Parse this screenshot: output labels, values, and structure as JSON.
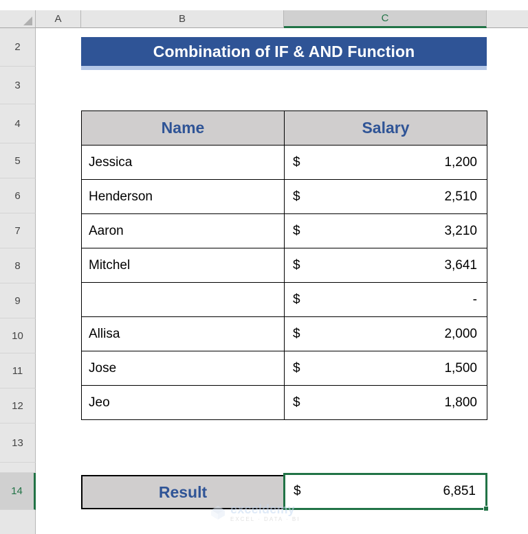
{
  "spreadsheet": {
    "columns": [
      {
        "label": "A",
        "selected": false
      },
      {
        "label": "B",
        "selected": false
      },
      {
        "label": "C",
        "selected": true
      }
    ],
    "rows": [
      "2",
      "3",
      "4",
      "5",
      "6",
      "7",
      "8",
      "9",
      "10",
      "11",
      "12",
      "13",
      "14"
    ],
    "selected_row": "14",
    "selected_cell": "C14"
  },
  "title": {
    "text": "Combination of IF & AND Function",
    "background": "#2F5496",
    "underline": "#B4C7E7",
    "color": "#FFFFFF"
  },
  "table": {
    "headers": [
      "Name",
      "Salary"
    ],
    "header_background": "#D0CECE",
    "header_color": "#2F5496",
    "currency_symbol": "$",
    "rows": [
      {
        "name": "Jessica",
        "amount": "1,200"
      },
      {
        "name": "Henderson",
        "amount": "2,510"
      },
      {
        "name": "Aaron",
        "amount": "3,210"
      },
      {
        "name": "Mitchel",
        "amount": "3,641"
      },
      {
        "name": "",
        "amount": "-"
      },
      {
        "name": "Allisa",
        "amount": "2,000"
      },
      {
        "name": "Jose",
        "amount": "1,500"
      },
      {
        "name": "Jeo",
        "amount": "1,800"
      }
    ]
  },
  "result": {
    "label": "Result",
    "currency_symbol": "$",
    "amount": "6,851",
    "selection_color": "#217346"
  },
  "watermark": {
    "name": "exceldemy",
    "tagline": "EXCEL · DATA · BI"
  },
  "chart_data": {
    "type": "table",
    "title": "Combination of IF & AND Function",
    "columns": [
      "Name",
      "Salary"
    ],
    "rows": [
      [
        "Jessica",
        1200
      ],
      [
        "Henderson",
        2510
      ],
      [
        "Aaron",
        3210
      ],
      [
        "Mitchel",
        3641
      ],
      [
        "",
        0
      ],
      [
        "Allisa",
        2000
      ],
      [
        "Jose",
        1500
      ],
      [
        "Jeo",
        1800
      ]
    ],
    "summary_label": "Result",
    "summary_value": 6851
  }
}
